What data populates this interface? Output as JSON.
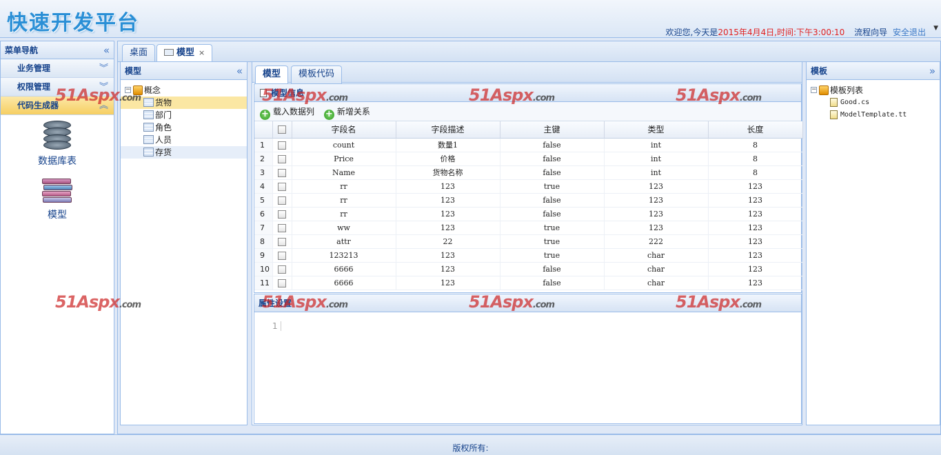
{
  "header": {
    "title": "快速开发平台",
    "welcome_prefix": "欢迎您,今天是",
    "datetime": "2015年4月4日,时间:下午3:00:10",
    "workflow_link": "流程向导",
    "logout_link": "安全退出"
  },
  "left_nav": {
    "title": "菜单导航",
    "sections": [
      {
        "label": "业务管理"
      },
      {
        "label": "权限管理"
      },
      {
        "label": "代码生成器"
      }
    ],
    "icons": [
      {
        "label": "数据库表",
        "icon": "database-icon"
      },
      {
        "label": "模型",
        "icon": "books-icon"
      }
    ]
  },
  "main_tabs": [
    {
      "label": "桌面"
    },
    {
      "label": "模型",
      "close": "×"
    }
  ],
  "model_panel": {
    "title": "模型",
    "root": "概念",
    "children": [
      "货物",
      "部门",
      "角色",
      "人员",
      "存货"
    ]
  },
  "center": {
    "tabs": [
      {
        "label": "模型"
      },
      {
        "label": "模板代码"
      }
    ],
    "info_title": "模型信息",
    "toolbar": {
      "load_columns": "载入数据列",
      "add_relation": "新增关系"
    },
    "columns": [
      "字段名",
      "字段描述",
      "主键",
      "类型",
      "长度"
    ],
    "rows": [
      [
        "1",
        "count",
        "数量1",
        "false",
        "int",
        "8"
      ],
      [
        "2",
        "Price",
        "价格",
        "false",
        "int",
        "8"
      ],
      [
        "3",
        "Name",
        "货物名称",
        "false",
        "int",
        "8"
      ],
      [
        "4",
        "rr",
        "123",
        "true",
        "123",
        "123"
      ],
      [
        "5",
        "rr",
        "123",
        "false",
        "123",
        "123"
      ],
      [
        "6",
        "rr",
        "123",
        "false",
        "123",
        "123"
      ],
      [
        "7",
        "ww",
        "123",
        "true",
        "123",
        "123"
      ],
      [
        "8",
        "attr",
        "22",
        "true",
        "222",
        "123"
      ],
      [
        "9",
        "123213",
        "123",
        "true",
        "char",
        "123"
      ],
      [
        "10",
        "6666",
        "123",
        "false",
        "char",
        "123"
      ],
      [
        "11",
        "6666",
        "123",
        "false",
        "char",
        "123"
      ]
    ],
    "prop_title": "属性设置",
    "editor_line": "1"
  },
  "template_panel": {
    "title": "模板",
    "root": "模板列表",
    "files": [
      "Good.cs",
      "ModelTemplate.tt"
    ]
  },
  "footer": {
    "copyright": "版权所有:"
  },
  "watermark": {
    "main": "51Aspx",
    "suffix": ".com"
  },
  "colors": {
    "accent": "#15428b",
    "border": "#99bbe8",
    "highlight": "#fbe7a3",
    "date_red": "#e02020"
  }
}
